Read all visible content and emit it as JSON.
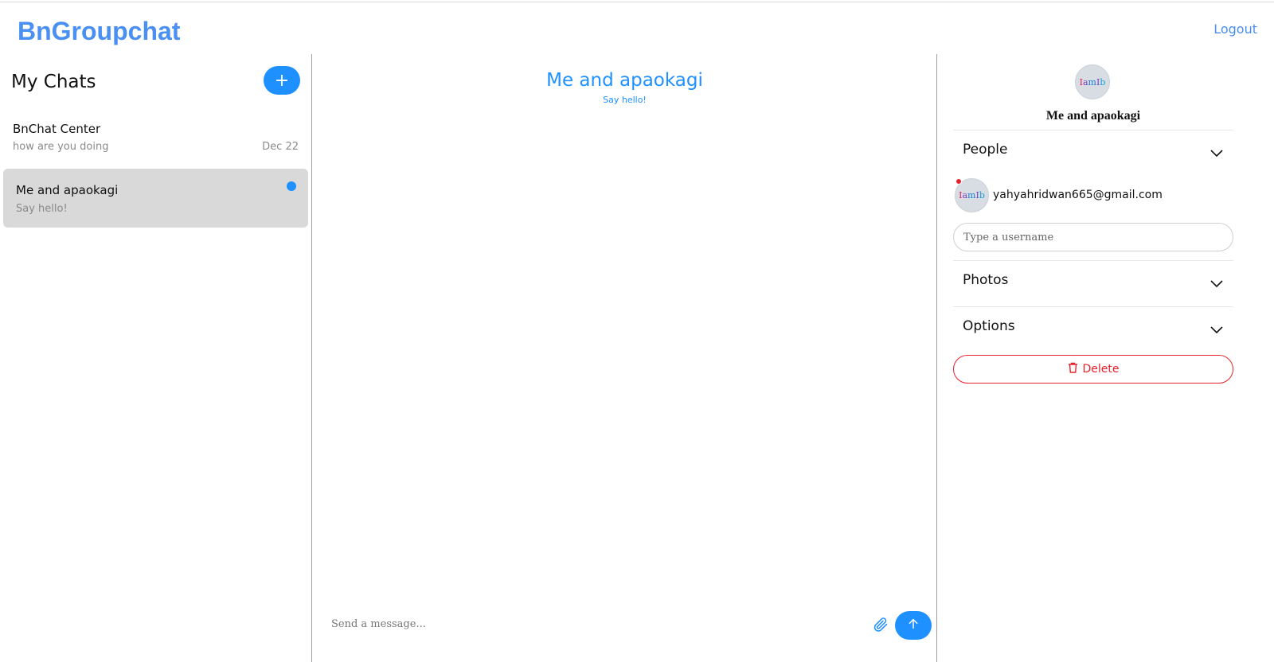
{
  "app": {
    "brand": "BnGroupchat",
    "logout_label": "Logout"
  },
  "sidebar": {
    "title": "My Chats",
    "add_icon": "plus-icon",
    "chats": [
      {
        "name": "BnChat Center",
        "snippet": "how are you doing",
        "date": "Dec 22",
        "selected": false,
        "unread": false
      },
      {
        "name": "Me and apaokagi",
        "snippet": "Say hello!",
        "date": "",
        "selected": true,
        "unread": true
      }
    ]
  },
  "chat": {
    "title": "Me and apaokagi",
    "subtitle": "Say hello!",
    "input_placeholder": "Send a message...",
    "attach_icon": "paperclip-icon",
    "send_icon": "arrow-up-icon"
  },
  "details": {
    "avatar_text": [
      "I",
      "a",
      "m",
      "I",
      "b"
    ],
    "title": "Me and apaokagi",
    "sections": {
      "people": "People",
      "photos": "Photos",
      "options": "Options"
    },
    "chevron_icon": "chevron-down-icon",
    "person": {
      "email": "yahyahridwan665@gmail.com",
      "online": true
    },
    "username_placeholder": "Type a username",
    "delete_label": "Delete",
    "delete_icon": "trash-icon"
  },
  "colors": {
    "accent": "#1e90ff",
    "brand": "#4a8ff2",
    "danger": "#e8222b",
    "selected_bg": "#d9d9d9"
  }
}
